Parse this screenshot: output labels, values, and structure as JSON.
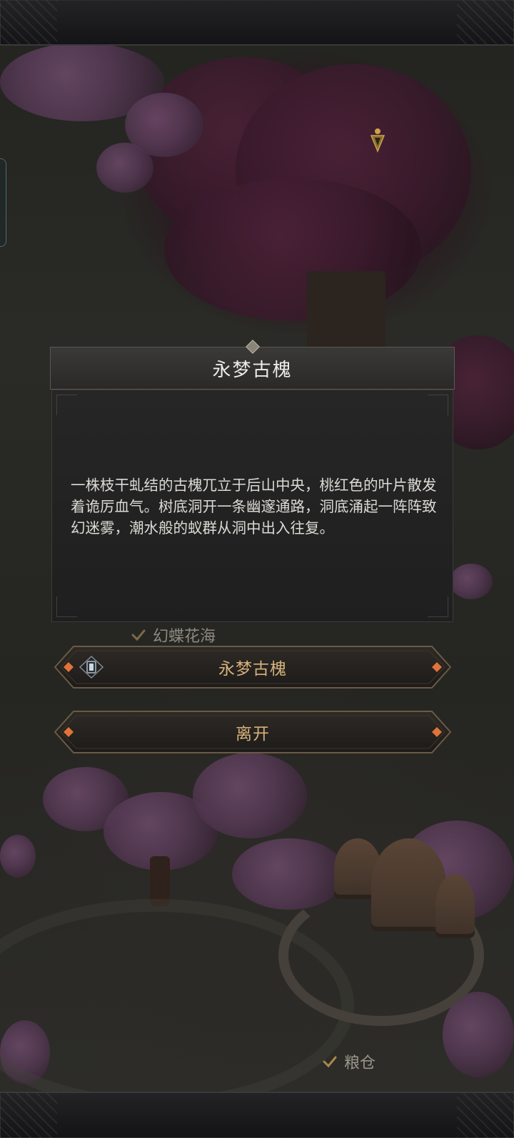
{
  "dialog": {
    "title": "永梦古槐",
    "description": "一株枝干虬结的古槐兀立于后山中央，桃红色的叶片散发着诡厉血气。树底洞开一条幽邃通路，洞底涌起一阵阵致幻迷雾，潮水般的蚁群从洞中出入往复。"
  },
  "options": [
    {
      "label": "永梦古槐",
      "icon": "lantern-icon"
    },
    {
      "label": "离开"
    }
  ],
  "map_labels": {
    "butterfly_sea": "幻蝶花海",
    "granary": "粮仓"
  },
  "colors": {
    "accent_gold": "#d6b27a",
    "ember_orange": "#e0733a",
    "dialog_bg": "#232323",
    "pin_gold": "#c9a24a"
  }
}
